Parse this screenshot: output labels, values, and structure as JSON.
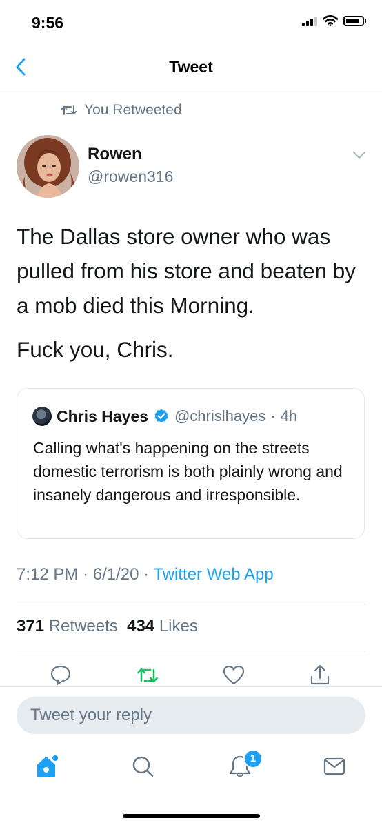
{
  "status_bar": {
    "time": "9:56"
  },
  "nav": {
    "title": "Tweet",
    "back_icon": "chevron-left-icon"
  },
  "retweet_context": {
    "label": "You Retweeted"
  },
  "tweet": {
    "author_name": "Rowen",
    "author_handle": "@rowen316",
    "text_paragraph_1": "The Dallas store owner who was pulled from his store and beaten by a mob died this Morning.",
    "text_paragraph_2": "Fuck you, Chris.",
    "time": "7:12 PM",
    "date": "6/1/20",
    "source": "Twitter Web App",
    "retweet_count": "371",
    "retweet_label": "Retweets",
    "like_count": "434",
    "like_label": "Likes"
  },
  "quoted_tweet": {
    "author_name": "Chris Hayes",
    "verified": true,
    "author_handle": "@chrislhayes",
    "age": "4h",
    "text": "Calling what's happening on the streets domestic terrorism is both plainly wrong and insanely dangerous and irresponsible."
  },
  "actions": [
    "reply-icon",
    "retweet-icon",
    "like-icon",
    "share-icon"
  ],
  "reply_box": {
    "placeholder": "Tweet your reply"
  },
  "tab_bar": {
    "tabs": [
      "home-icon",
      "search-icon",
      "notifications-icon",
      "messages-icon"
    ],
    "notification_badge": "1"
  },
  "colors": {
    "accent": "#1da1f2",
    "retweet_active": "#17bf63",
    "secondary_text": "#657786",
    "divider": "#e1e8ed"
  }
}
